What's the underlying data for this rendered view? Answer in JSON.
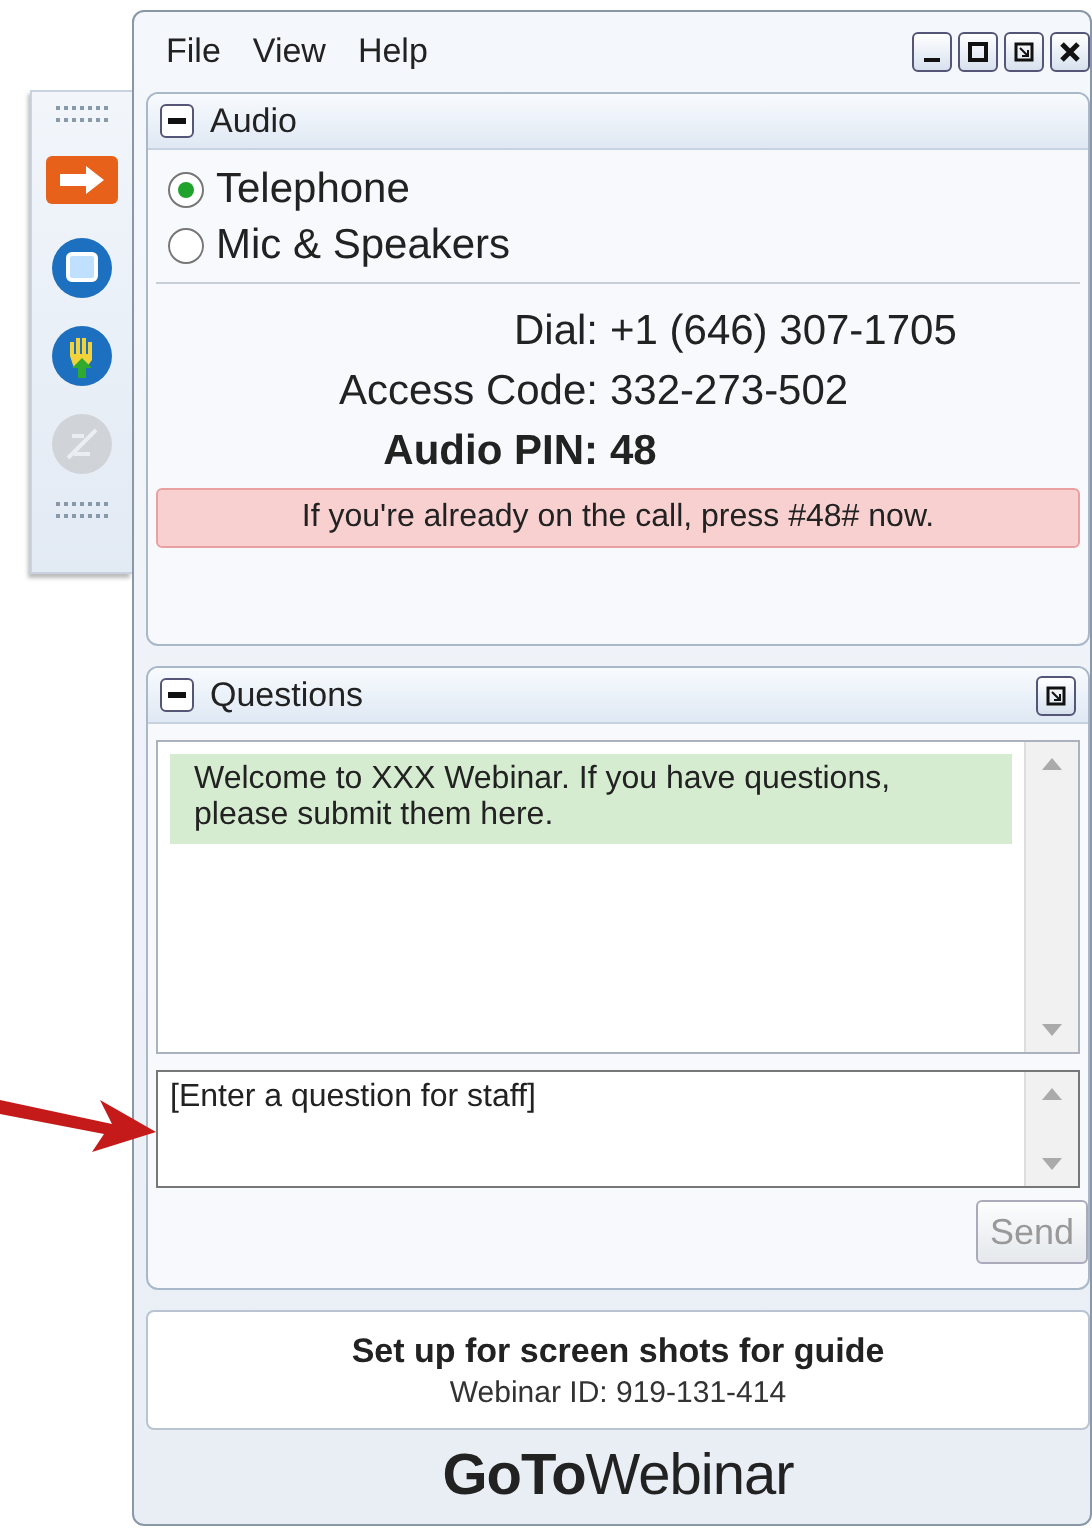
{
  "toolbar": [
    {
      "kind": "arrow",
      "disabled": false
    },
    {
      "kind": "screen",
      "disabled": false
    },
    {
      "kind": "hand",
      "disabled": false
    },
    {
      "kind": "slash",
      "disabled": true
    }
  ],
  "menu": [
    "File",
    "View",
    "Help"
  ],
  "window_controls": [
    {
      "kind": "minimize"
    },
    {
      "kind": "maximize"
    },
    {
      "kind": "restore"
    },
    {
      "kind": "close"
    }
  ],
  "audio": {
    "title": "Audio",
    "options": [
      {
        "label": "Telephone",
        "selected": true
      },
      {
        "label": "Mic & Speakers",
        "selected": false
      }
    ],
    "lines": [
      {
        "label": "Dial:",
        "value": "+1 (646) 307-1705",
        "bold": false
      },
      {
        "label": "Access Code:",
        "value": "332-273-502",
        "bold": false
      },
      {
        "label": "Audio PIN:",
        "value": "48",
        "bold": true
      }
    ],
    "notice": "If you're already on the call, press #48# now."
  },
  "questions": {
    "title": "Questions",
    "messages": [
      "Welcome to XXX Webinar. If you have questions, please submit them here."
    ],
    "input_placeholder": "[Enter a question for staff]",
    "send": {
      "label": "Send",
      "disabled": true
    }
  },
  "footer": {
    "title": "Set up for screen shots for guide",
    "webinar_id": "Webinar ID: 919-131-414"
  },
  "logo": {
    "bold": "GoTo",
    "light": "Webinar"
  }
}
